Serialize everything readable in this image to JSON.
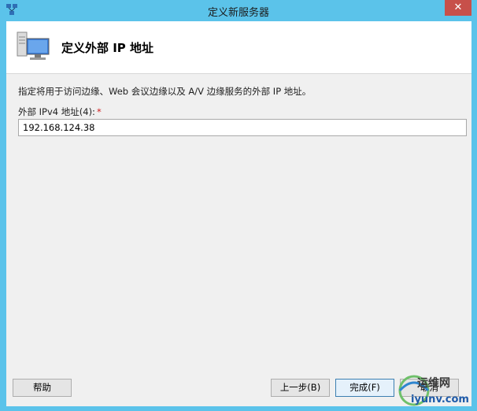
{
  "window": {
    "title": "定义新服务器",
    "close_glyph": "✕",
    "app_icon": "server-topology-icon"
  },
  "header": {
    "icon": "computer-server-icon",
    "title": "定义外部 IP 地址"
  },
  "form": {
    "description": "指定将用于访问边缘、Web 会议边缘以及 A/V 边缘服务的外部 IP 地址。",
    "ipv4_label": "外部 IPv4 地址(4):",
    "required_marker": "*",
    "ipv4_value": "192.168.124.38"
  },
  "buttons": {
    "help": "帮助",
    "prev": "上一步(B)",
    "finish": "完成(F)",
    "cancel": "取消"
  },
  "watermark": {
    "line1": "运维网",
    "line2": "iyunv.com"
  }
}
